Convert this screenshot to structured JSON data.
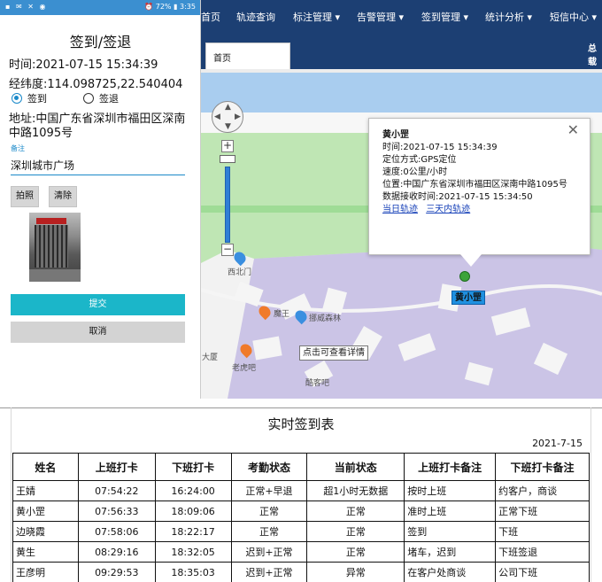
{
  "phone": {
    "status_left": "▪ ✉ ✕ ◉",
    "status_right": "⏰ 72% ▮ 3:35",
    "title": "签到/签退",
    "time_line": "时间:2021-07-15 15:34:39",
    "coords_line": "经纬度:114.098725,22.540404",
    "radio_checkin": "签到",
    "radio_checkout": "签退",
    "address": "地址:中国广东省深圳市福田区深南中路1095号",
    "note_label": "备注",
    "note_value": "深圳城市广场",
    "photo_button": "拍照",
    "clear_button": "清除",
    "submit_button": "提交",
    "cancel_button": "取消"
  },
  "nav": {
    "items": [
      "首页",
      "轨迹查询",
      "标注管理 ▾",
      "告警管理 ▾",
      "签到管理 ▾",
      "统计分析 ▾",
      "短信中心 ▾"
    ],
    "tab": "首页",
    "user": "总载"
  },
  "map": {
    "popup": {
      "name": "黄小罡",
      "time": "时间:2021-07-15 15:34:39",
      "method": "定位方式:GPS定位",
      "speed": "速度:0公里/小时",
      "position": "位置:中国广东省深圳市福田区深南中路1095号",
      "received": "数据接收时间:2021-07-15 15:34:50",
      "link_today": "当日轨迹",
      "link_three_days": "三天内轨迹",
      "close": "✕"
    },
    "marker_label": "黄小罡",
    "tooltip": "点击可查看详情",
    "poi": [
      "西北门",
      "魔王",
      "挪威森林",
      "大厦",
      "老虎吧",
      "酷客吧"
    ],
    "zoom_in": "+",
    "zoom_out": "−",
    "colors": {
      "road": "#f7f7f7",
      "park": "#bfe6b4",
      "campus": "#c8c2e2",
      "water": "#a8c8f0"
    }
  },
  "sheet": {
    "title": "实时签到表",
    "date": "2021-7-15",
    "headers": [
      "姓名",
      "上班打卡",
      "下班打卡",
      "考勤状态",
      "当前状态",
      "上班打卡备注",
      "下班打卡备注"
    ],
    "rows": [
      [
        "王婧",
        "07:54:22",
        "16:24:00",
        "正常+早退",
        "超1小时无数据",
        "按时上班",
        "约客户，商谈"
      ],
      [
        "黄小罡",
        "07:56:33",
        "18:09:06",
        "正常",
        "正常",
        "准时上班",
        "正常下班"
      ],
      [
        "边晓霞",
        "07:58:06",
        "18:22:17",
        "正常",
        "正常",
        "签到",
        "下班"
      ],
      [
        "黄生",
        "08:29:16",
        "18:32:05",
        "迟到+正常",
        "正常",
        "堵车，迟到",
        "下班签退"
      ],
      [
        "王彦明",
        "09:29:53",
        "18:35:03",
        "迟到+正常",
        "异常",
        "在客户处商谈",
        "公司下班"
      ]
    ]
  }
}
